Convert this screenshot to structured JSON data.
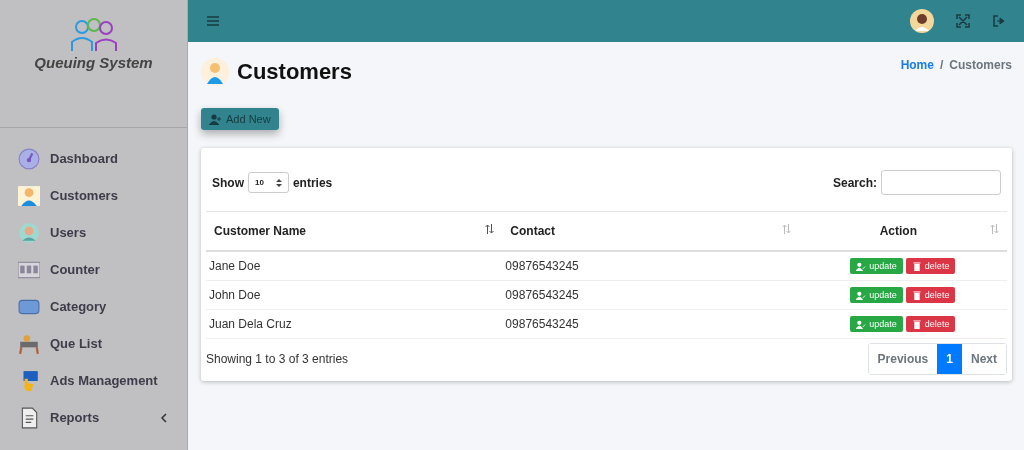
{
  "sidebar": {
    "brand": "Queuing System",
    "items": [
      {
        "label": "Dashboard",
        "kind": "gauge",
        "expandable": false
      },
      {
        "label": "Customers",
        "kind": "person",
        "expandable": false
      },
      {
        "label": "Users",
        "kind": "user",
        "expandable": false
      },
      {
        "label": "Counter",
        "kind": "counter",
        "expandable": false
      },
      {
        "label": "Category",
        "kind": "folder",
        "expandable": false
      },
      {
        "label": "Que List",
        "kind": "queue",
        "expandable": false
      },
      {
        "label": "Ads Management",
        "kind": "ads",
        "expandable": false
      },
      {
        "label": "Reports",
        "kind": "report",
        "expandable": true
      }
    ]
  },
  "header": {
    "page_title": "Customers",
    "breadcrumb": [
      {
        "label": "Home",
        "link": true
      },
      {
        "label": "/",
        "link": false
      },
      {
        "label": "Customers",
        "link": false
      }
    ],
    "add_button": "Add New"
  },
  "table": {
    "show_label": "Show",
    "page_size": "10",
    "entries_label": "entries",
    "search_label": "Search:",
    "columns": [
      "Customer Name",
      "Contact",
      "Action"
    ],
    "rows": [
      {
        "name": "Jane Doe",
        "contact": "09876543245",
        "actions": [
          "update",
          "delete"
        ]
      },
      {
        "name": "John Doe",
        "contact": "09876543245",
        "actions": [
          "update",
          "delete"
        ]
      },
      {
        "name": "Juan Dela Cruz",
        "contact": "09876543245",
        "actions": [
          "update",
          "delete"
        ]
      }
    ],
    "info": "Showing 1 to 3 of 3 entries",
    "pagination": [
      {
        "label": "Previous",
        "selected": false
      },
      {
        "label": "1",
        "selected": true
      },
      {
        "label": "Next",
        "selected": false
      }
    ]
  }
}
